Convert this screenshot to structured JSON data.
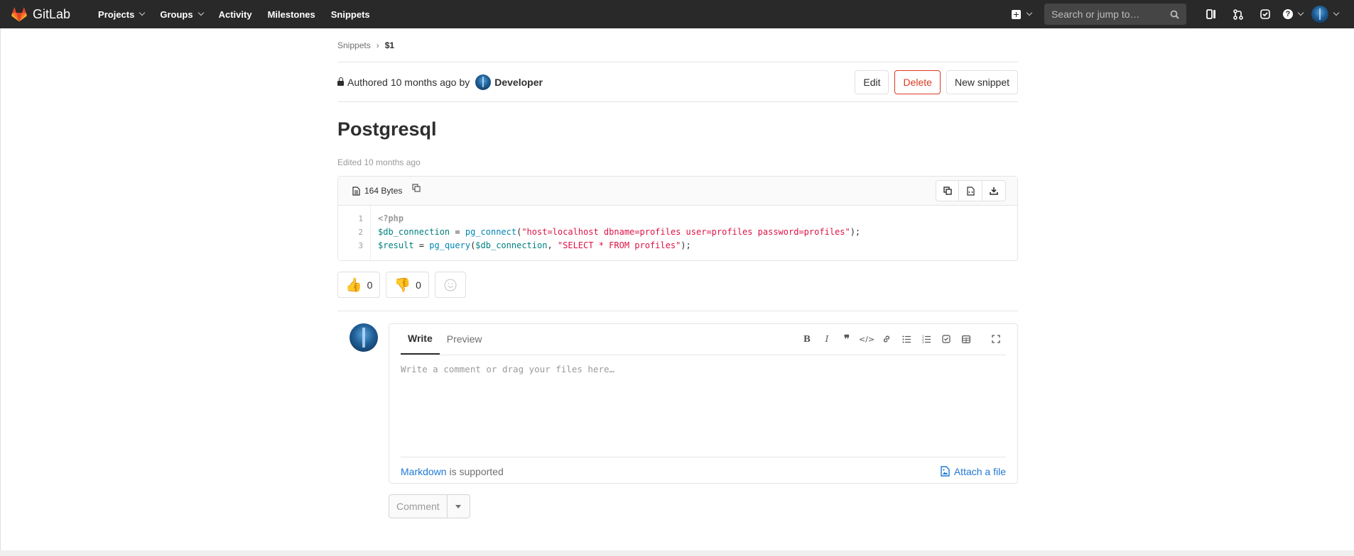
{
  "app": {
    "name": "GitLab"
  },
  "nav": {
    "items": [
      {
        "label": "Projects",
        "dropdown": true
      },
      {
        "label": "Groups",
        "dropdown": true
      },
      {
        "label": "Activity",
        "dropdown": false
      },
      {
        "label": "Milestones",
        "dropdown": false
      },
      {
        "label": "Snippets",
        "dropdown": false
      }
    ],
    "search_placeholder": "Search or jump to…",
    "help_symbol": "?"
  },
  "breadcrumb": {
    "root": "Snippets",
    "current": "$1"
  },
  "snippet": {
    "authored_prefix": "Authored",
    "authored_time": "10 months ago",
    "authored_by": "by",
    "author": "Developer",
    "title": "Postgresql",
    "edited_prefix": "Edited",
    "edited_time": "10 months ago",
    "file_size": "164 Bytes",
    "visibility": "private"
  },
  "actions": {
    "edit": "Edit",
    "delete": "Delete",
    "new_snippet": "New snippet"
  },
  "code": {
    "line_numbers": [
      "1",
      "2",
      "3"
    ],
    "line1": "<?php",
    "line2": {
      "var": "$db_connection",
      "eq": " = ",
      "fn": "pg_connect",
      "open": "(",
      "str": "\"host=localhost dbname=profiles user=profiles password=profiles\"",
      "close": ");"
    },
    "line3": {
      "var": "$result",
      "eq": " = ",
      "fn": "pg_query",
      "open": "(",
      "arg": "$db_connection",
      "comma": ", ",
      "str": "\"SELECT * FROM profiles\"",
      "close": ");"
    }
  },
  "awards": {
    "thumbsup_count": "0",
    "thumbsdown_count": "0",
    "thumbsup_emoji": "👍",
    "thumbsdown_emoji": "👎"
  },
  "comment": {
    "tab_write": "Write",
    "tab_preview": "Preview",
    "placeholder": "Write a comment or drag your files here…",
    "markdown_link": "Markdown",
    "supported_text": " is supported",
    "attach": "Attach a file",
    "submit": "Comment"
  },
  "colors": {
    "topbar": "#292929",
    "danger": "#db3b21",
    "link": "#1f78d1",
    "code_var": "#008080",
    "code_string": "#dd1144",
    "code_fn": "#0086b3"
  }
}
